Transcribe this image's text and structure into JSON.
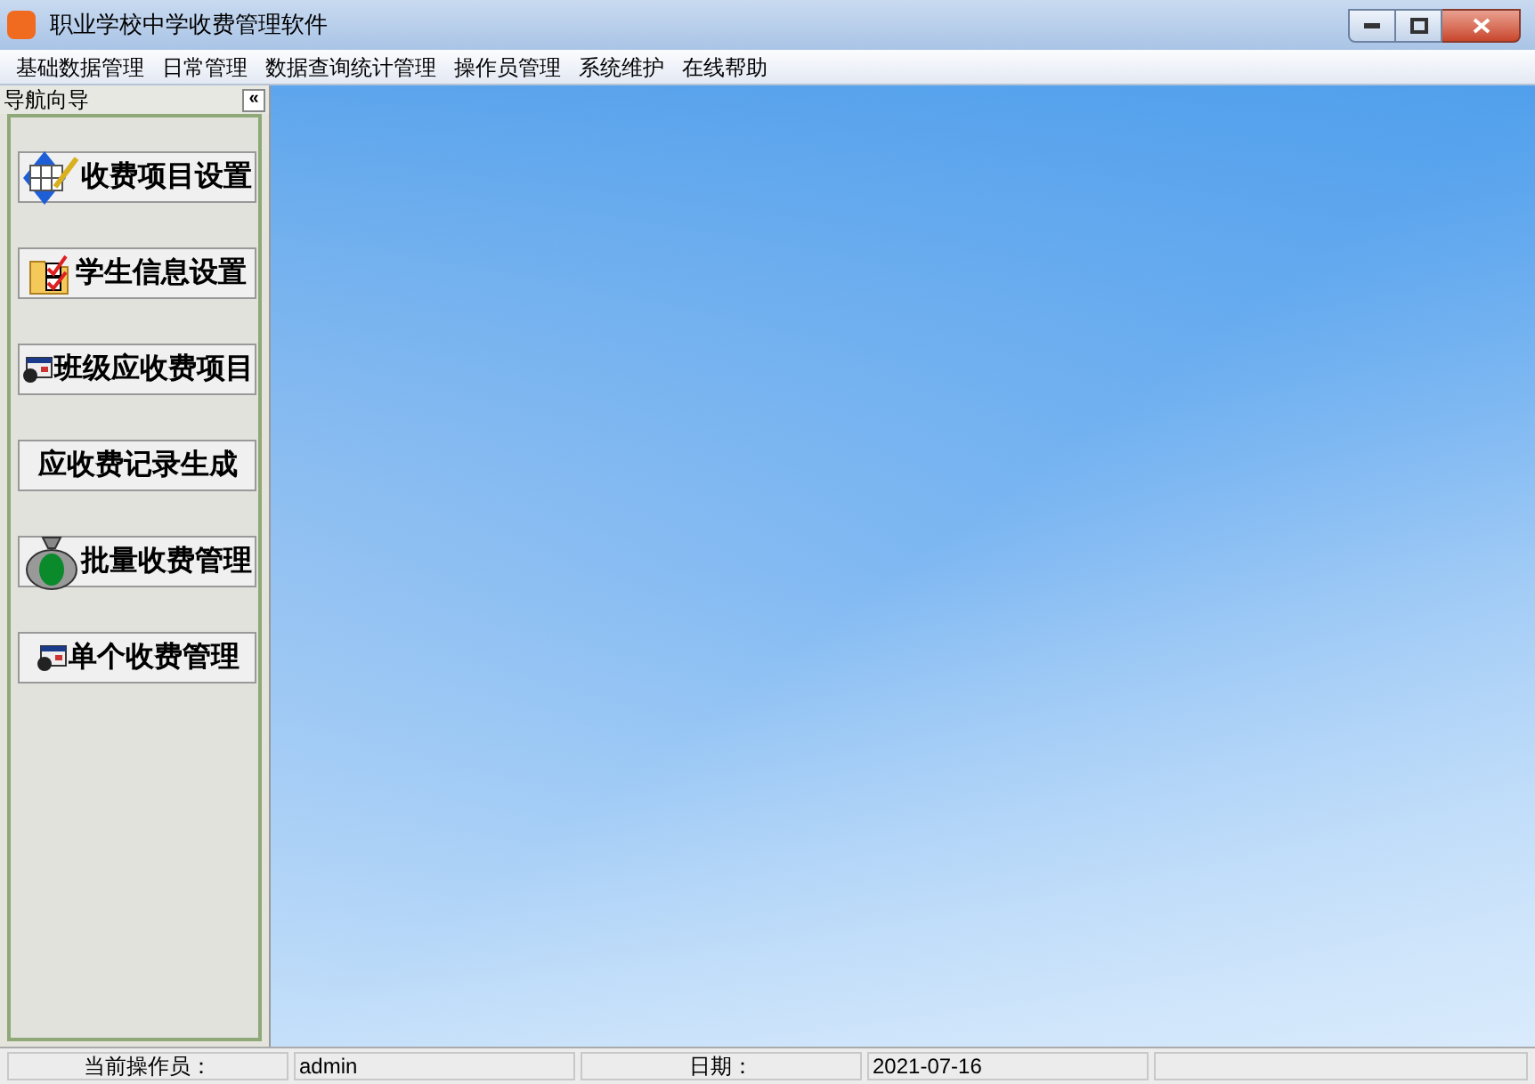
{
  "window": {
    "title": "职业学校中学收费管理软件"
  },
  "menu": [
    "基础数据管理",
    "日常管理",
    "数据查询统计管理",
    "操作员管理",
    "系统维护",
    "在线帮助"
  ],
  "sidebar": {
    "title": "导航向导",
    "collapse": "«",
    "items": [
      {
        "label": "收费项目设置",
        "kind": "grid"
      },
      {
        "label": "学生信息设置",
        "kind": "folder"
      },
      {
        "label": "班级应收费项目",
        "kind": "form"
      },
      {
        "label": "应收费记录生成",
        "kind": "none"
      },
      {
        "label": "批量收费管理",
        "kind": "money"
      },
      {
        "label": "单个收费管理",
        "kind": "form"
      }
    ]
  },
  "status_bar": [
    {
      "label": "当前操作员：",
      "value": "admin"
    },
    {
      "label": "日期：",
      "value": "2021-07-16"
    }
  ]
}
